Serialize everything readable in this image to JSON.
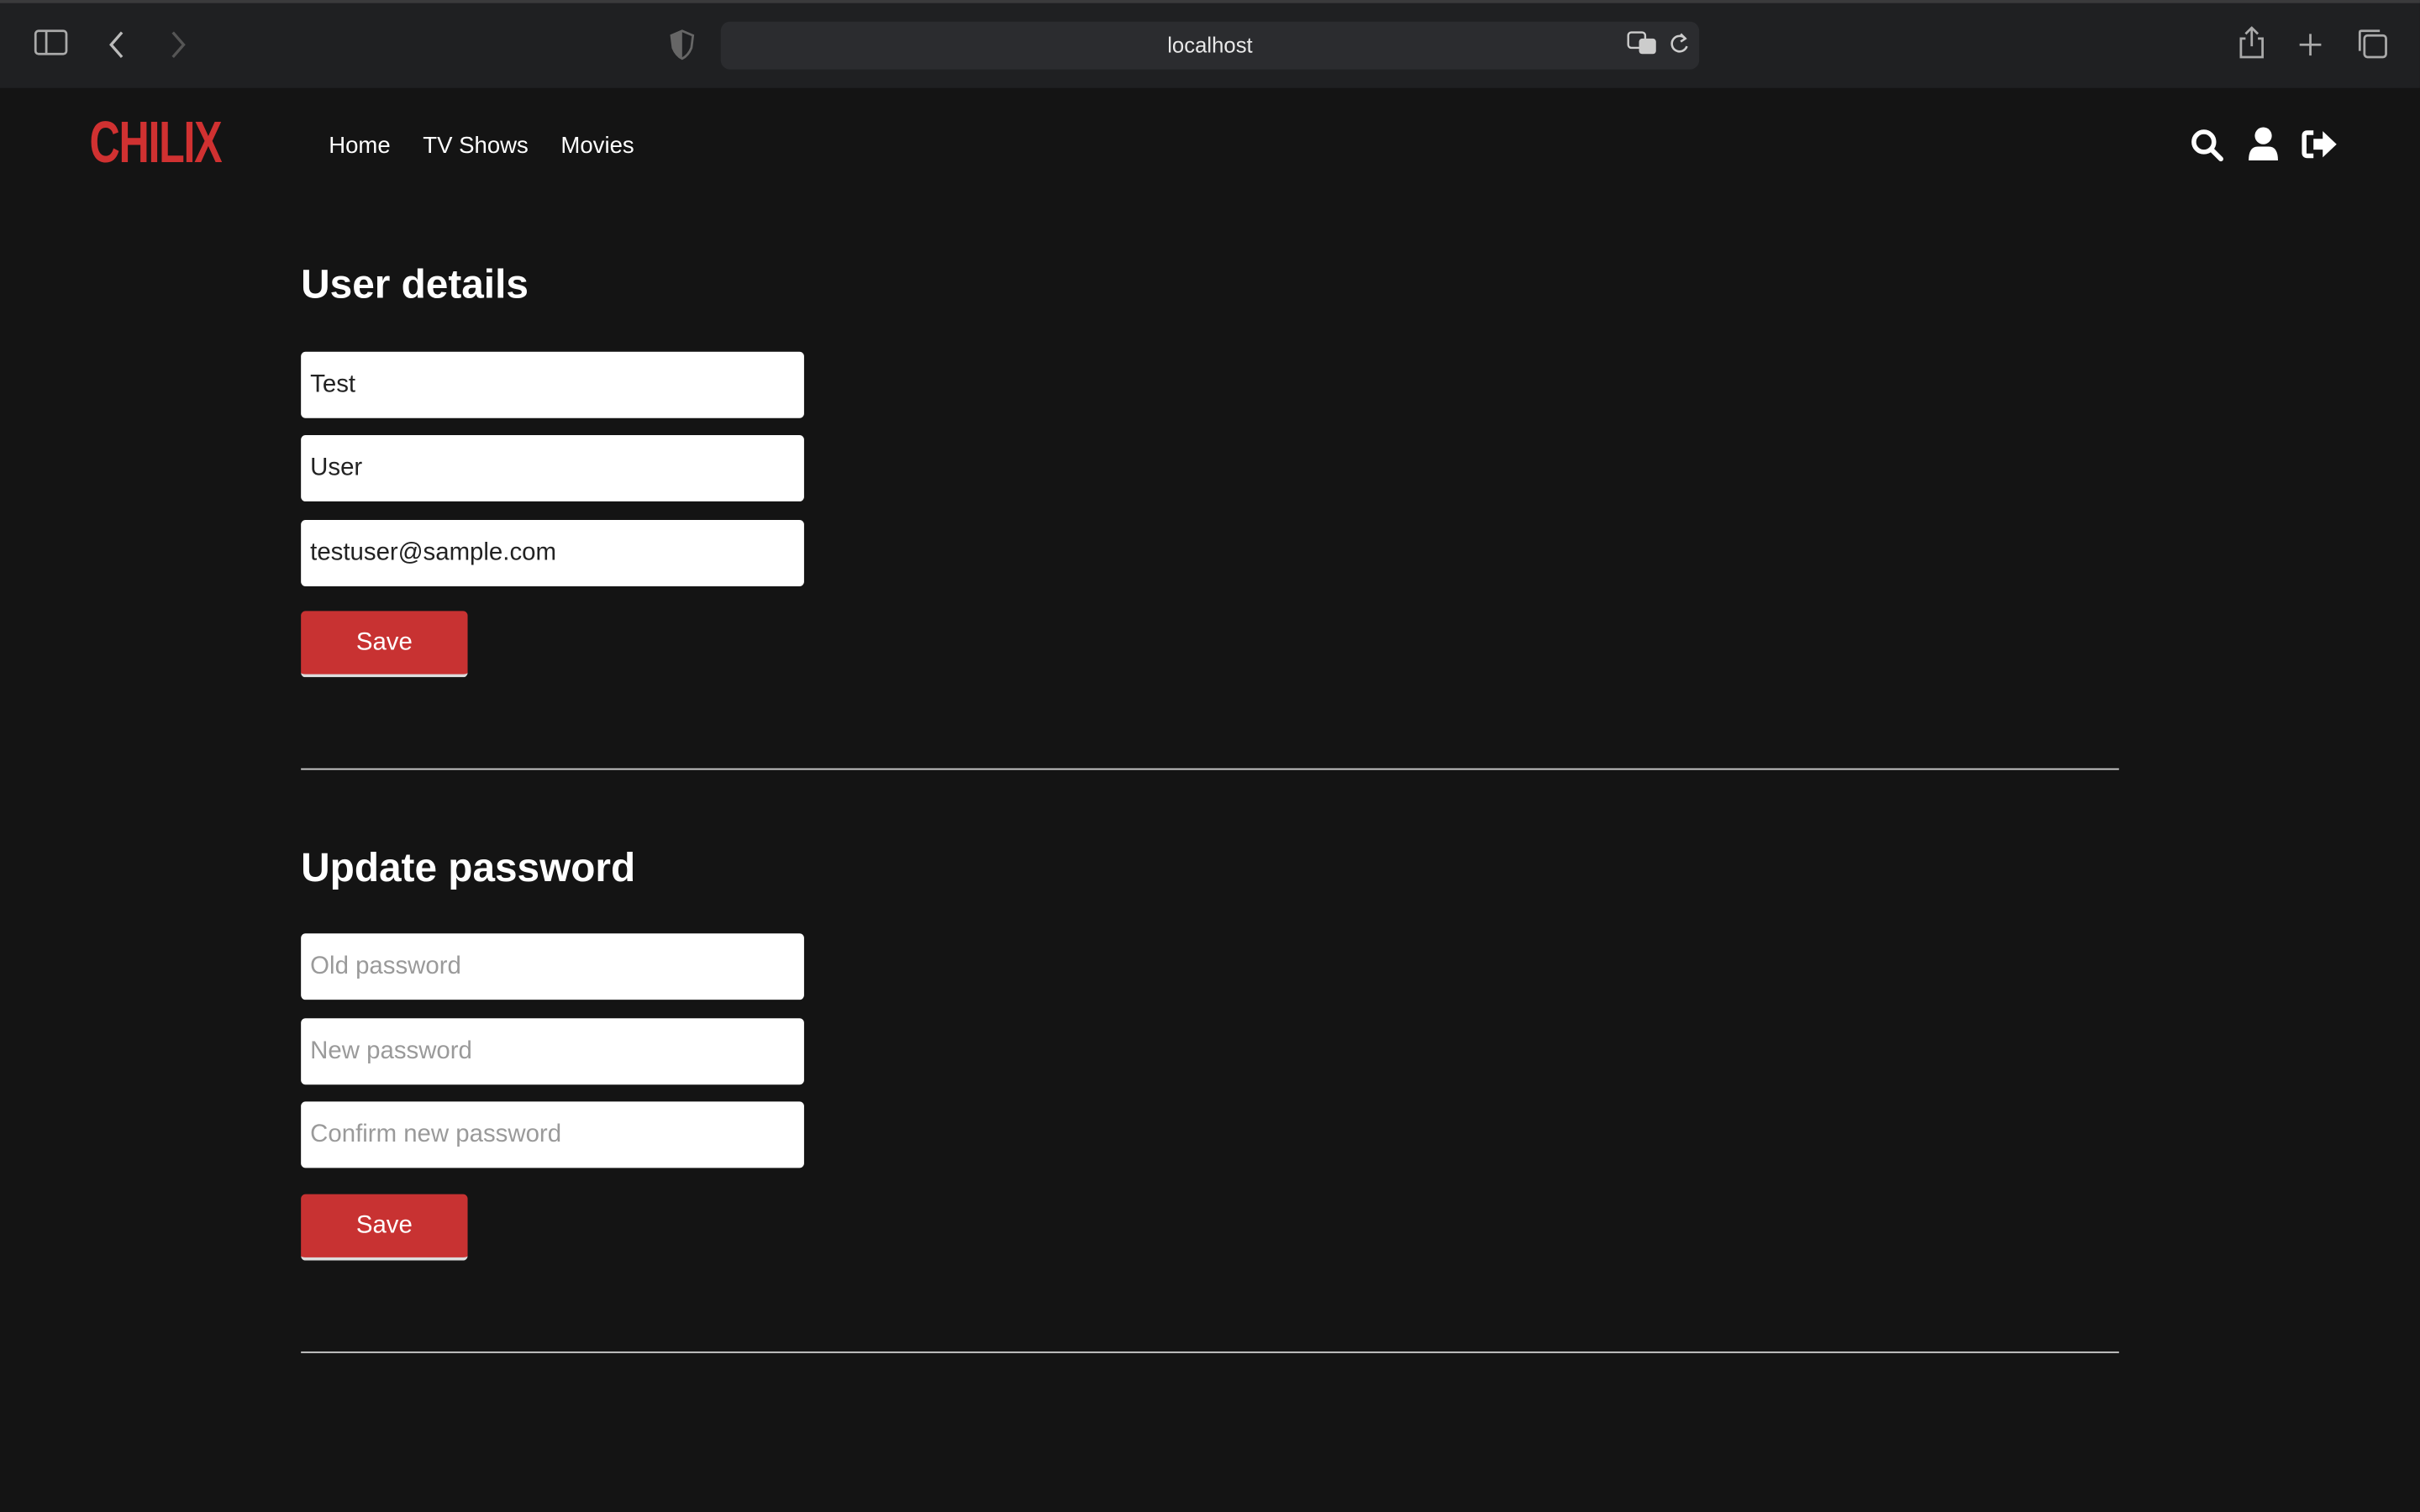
{
  "browser": {
    "url": "localhost",
    "icons": [
      "sidebar-icon",
      "back-icon",
      "forward-icon",
      "shield-icon",
      "translate-icon",
      "reload-icon",
      "share-icon",
      "new-tab-icon",
      "tabs-overview-icon"
    ]
  },
  "header": {
    "logo": "CHILIX",
    "nav": [
      {
        "label": "Home"
      },
      {
        "label": "TV Shows"
      },
      {
        "label": "Movies"
      }
    ],
    "icons": [
      "search-icon",
      "user-icon",
      "logout-icon"
    ],
    "brand_color": "#d03131"
  },
  "user_details": {
    "title": "User details",
    "first_name": "Test",
    "last_name": "User",
    "email": "testuser@sample.com",
    "save_label": "Save"
  },
  "update_password": {
    "title": "Update password",
    "old_placeholder": "Old password",
    "new_placeholder": "New password",
    "confirm_placeholder": "Confirm new password",
    "save_label": "Save"
  },
  "colors": {
    "background": "#141414",
    "button": "#c83232"
  }
}
